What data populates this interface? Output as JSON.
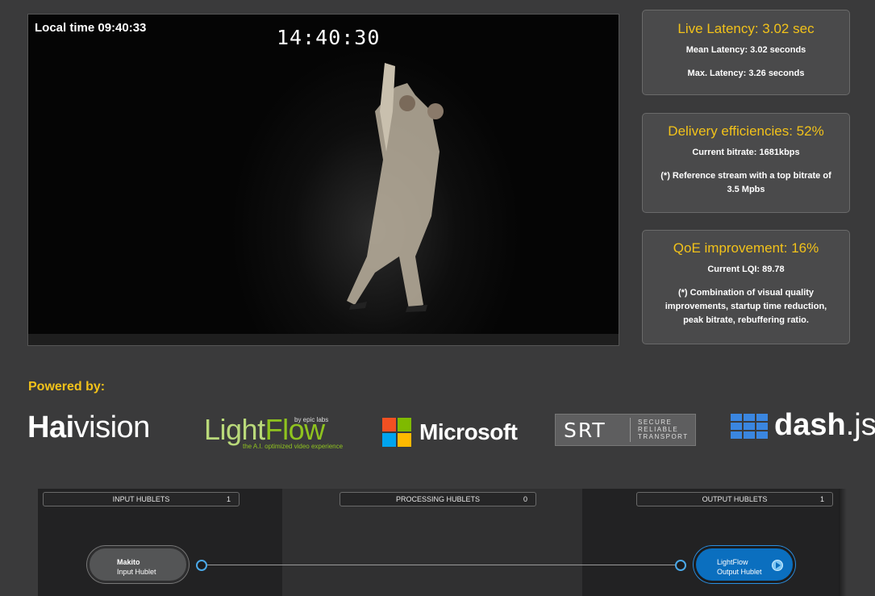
{
  "video": {
    "local_time": "Local time 09:40:33",
    "clock": "14:40:30"
  },
  "metrics": {
    "latency": {
      "title": "Live Latency: 3.02 sec",
      "mean": "Mean Latency: 3.02 seconds",
      "max": "Max. Latency: 3.26 seconds"
    },
    "delivery": {
      "title": "Delivery efficiencies: 52%",
      "bitrate": "Current bitrate: 1681kbps",
      "note": "(*) Reference stream with a top bitrate of 3.5 Mpbs"
    },
    "qoe": {
      "title": "QoE improvement: 16%",
      "lqi": "Current LQI: 89.78",
      "note": "(*) Combination of visual quality improvements, startup time reduction, peak bitrate, rebuffering ratio."
    }
  },
  "powered_by": {
    "label": "Powered by:",
    "logos": {
      "haivision_a": "Hai",
      "haivision_b": "vision",
      "lightflow_a": "Light",
      "lightflow_b": "Flow",
      "lightflow_by": "by epic labs",
      "lightflow_tagline": "the A.I. optimized video experience",
      "microsoft": "Microsoft",
      "srt": "SRT",
      "srt_line1": "SECURE",
      "srt_line2": "RELIABLE",
      "srt_line3": "TRANSPORT",
      "dash_a": "dash",
      "dash_b": ".js"
    }
  },
  "pipeline": {
    "input": {
      "label": "INPUT HUBLETS",
      "count": "1"
    },
    "processing": {
      "label": "PROCESSING HUBLETS",
      "count": "0"
    },
    "output": {
      "label": "OUTPUT HUBLETS",
      "count": "1"
    },
    "input_node": {
      "name": "Makito",
      "type": "Input Hublet"
    },
    "output_node": {
      "name": "LightFlow",
      "type": "Output Hublet"
    }
  },
  "colors": {
    "accent_yellow": "#f2c21a",
    "lightflow_green": "#8fc31f",
    "hublet_blue": "#0b6fbf",
    "dash_blue": "#3a86e0"
  }
}
